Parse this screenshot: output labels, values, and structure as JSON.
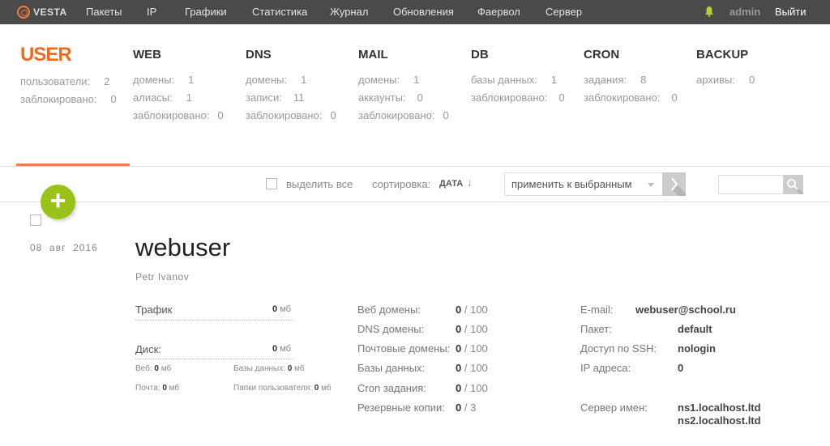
{
  "topbar": {
    "logo_text": "VESTA",
    "nav": [
      "Пакеты",
      "IP",
      "Графики",
      "Статистика",
      "Журнал",
      "Обновления",
      "Фаервол",
      "Сервер"
    ],
    "user": "admin",
    "logout": "Выйти"
  },
  "stats": {
    "user": {
      "title": "USER",
      "rows": [
        {
          "label": "пользователи:",
          "value": "2"
        },
        {
          "label": "заблокировано:",
          "value": "0"
        }
      ]
    },
    "web": {
      "title": "WEB",
      "rows": [
        {
          "label": "домены:",
          "value": "1"
        },
        {
          "label": "алиасы:",
          "value": "1"
        },
        {
          "label": "заблокировано:",
          "value": "0"
        }
      ]
    },
    "dns": {
      "title": "DNS",
      "rows": [
        {
          "label": "домены:",
          "value": "1"
        },
        {
          "label": "записи:",
          "value": "11"
        },
        {
          "label": "заблокировано:",
          "value": "0"
        }
      ]
    },
    "mail": {
      "title": "MAIL",
      "rows": [
        {
          "label": "домены:",
          "value": "1"
        },
        {
          "label": "аккаунты:",
          "value": "0"
        },
        {
          "label": "заблокировано:",
          "value": "0"
        }
      ]
    },
    "db": {
      "title": "DB",
      "rows": [
        {
          "label": "базы данных:",
          "value": "1"
        },
        {
          "label": "заблокировано:",
          "value": "0"
        }
      ]
    },
    "cron": {
      "title": "CRON",
      "rows": [
        {
          "label": "задания:",
          "value": "8"
        },
        {
          "label": "заблокировано:",
          "value": "0"
        }
      ]
    },
    "backup": {
      "title": "BACKUP",
      "rows": [
        {
          "label": "архивы:",
          "value": "0"
        }
      ]
    }
  },
  "toolbar": {
    "select_all": "выделить все",
    "sort_label": "сортировка:",
    "sort_value": "ДАТА",
    "sort_arrow": "↓",
    "apply_placeholder": "применить к выбранным"
  },
  "add_button": "+",
  "user_entry": {
    "date": "08  авг  2016",
    "username": "webuser",
    "fullname": "Petr Ivanov",
    "usage": {
      "traffic_label": "Трафик",
      "traffic_value": "0",
      "traffic_unit": "мб",
      "disk_label": "Диск:",
      "disk_value": "0",
      "disk_unit": "мб",
      "web_label": "Веб:",
      "web_value": "0",
      "web_unit": "мб",
      "db_label": "Базы данных:",
      "db_value": "0",
      "db_unit": "мб",
      "mail_label": "Почта:",
      "mail_value": "0",
      "mail_unit": "мб",
      "udir_label": "Папки пользователя:",
      "udir_value": "0",
      "udir_unit": "мб"
    },
    "limits": [
      {
        "label": "Веб домены:",
        "used": "0",
        "limit": "/ 100"
      },
      {
        "label": "DNS домены:",
        "used": "0",
        "limit": "/ 100"
      },
      {
        "label": "Почтовые домены:",
        "used": "0",
        "limit": "/ 100"
      },
      {
        "label": "Базы данных:",
        "used": "0",
        "limit": "/ 100"
      },
      {
        "label": "Cron задания:",
        "used": "0",
        "limit": "/ 100"
      },
      {
        "label": "Резервные копии:",
        "used": "0",
        "limit": "/ 3"
      }
    ],
    "info": {
      "email_label": "E-mail:",
      "email": "webuser@school.ru",
      "package_label": "Пакет:",
      "package": "default",
      "ssh_label": "Доступ по SSH:",
      "ssh": "nologin",
      "ip_label": "IP адреса:",
      "ip": "0",
      "ns_label": "Сервер имен:",
      "ns1": "ns1.localhost.ltd",
      "ns2": "ns2.localhost.ltd"
    }
  },
  "colors": {
    "accent": "#f06b1f",
    "topbar": "#4a4a4a",
    "add": "#9ac21a",
    "bell": "#b7d036"
  }
}
